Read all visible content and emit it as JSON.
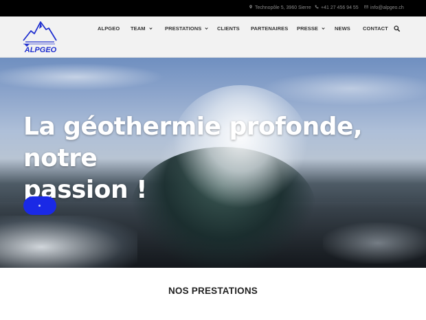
{
  "topbar": {
    "address": "Technopôle 5, 3960 Sierre",
    "phone": "+41 27 456 94 55",
    "email": "info@alpgeo.ch",
    "address_icon": "map-pin-icon",
    "phone_icon": "phone-icon",
    "email_icon": "envelope-icon"
  },
  "logo": {
    "alt": "ALPGEO",
    "text": "ALPGEO"
  },
  "nav": {
    "items": [
      {
        "label": "ALPGEO",
        "dropdown": false
      },
      {
        "label": "TEAM",
        "dropdown": true
      },
      {
        "label": "PRESTATIONS",
        "dropdown": true
      },
      {
        "label": "CLIENTS",
        "dropdown": false
      },
      {
        "label": "PARTENAIRES",
        "dropdown": false
      },
      {
        "label": "PRESSE",
        "dropdown": true
      },
      {
        "label": "NEWS",
        "dropdown": false
      },
      {
        "label": "CONTACT",
        "dropdown": false
      }
    ],
    "search_icon": "search-icon"
  },
  "hero": {
    "title_line1": "La géothermie profonde, notre",
    "title_line2": "passion !"
  },
  "colors": {
    "topbar_bg": "#000000",
    "header_bg": "#f2f2f2",
    "accent_button": "#1a29e6",
    "logo_blue": "#1f2fd0"
  },
  "section": {
    "title": "NOS PRESTATIONS"
  }
}
